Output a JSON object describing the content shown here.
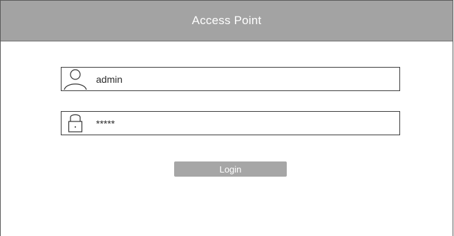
{
  "window": {
    "title": "Access Point"
  },
  "login_form": {
    "username": {
      "value": "admin",
      "icon": "user-icon"
    },
    "password": {
      "value": "*****",
      "icon": "lock-icon"
    },
    "login_label": "Login"
  },
  "colors": {
    "title_bar": "#a3a3a3",
    "button": "#a6a6a6",
    "border": "#3a3a3a"
  }
}
